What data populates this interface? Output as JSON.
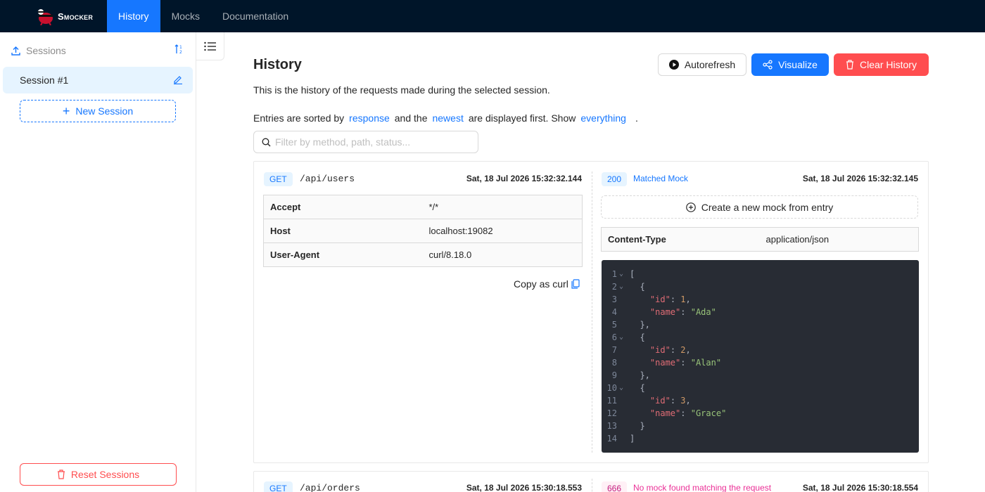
{
  "nav": {
    "brand": "Smocker",
    "tabs": [
      {
        "label": "History",
        "active": true
      },
      {
        "label": "Mocks",
        "active": false
      },
      {
        "label": "Documentation",
        "active": false
      }
    ]
  },
  "sidebar": {
    "sessions_label": "Sessions",
    "sessions": [
      {
        "name": "Session #1",
        "selected": true
      }
    ],
    "new_session_label": "New Session",
    "reset_sessions_label": "Reset Sessions"
  },
  "main": {
    "title": "History",
    "description": "This is the history of the requests made during the selected session.",
    "sort_line": {
      "p1": "Entries are sorted by",
      "sort_field": "response",
      "p2": "and the",
      "order": "newest",
      "p3": "are displayed first. Show",
      "show": "everything",
      "p4": "."
    },
    "buttons": {
      "autorefresh": "Autorefresh",
      "visualize": "Visualize",
      "clear": "Clear History"
    },
    "filter_placeholder": "Filter by method, path, status..."
  },
  "entries": [
    {
      "request": {
        "method": "GET",
        "path": "/api/users",
        "date": "Sat, 18 Jul 2026 15:32:32.144",
        "headers": [
          {
            "key": "Accept",
            "value": "*/*"
          },
          {
            "key": "Host",
            "value": "localhost:19082"
          },
          {
            "key": "User-Agent",
            "value": "curl/8.18.0"
          }
        ],
        "copy_curl": "Copy as curl"
      },
      "response": {
        "status": "200",
        "mock_status": "Matched Mock",
        "date": "Sat, 18 Jul 2026 15:32:32.145",
        "create_mock_label": "Create a new mock from entry",
        "headers": [
          {
            "key": "Content-Type",
            "value": "application/json"
          }
        ],
        "body_lines": [
          {
            "n": "1",
            "fold": true
          },
          {
            "n": "2",
            "fold": true
          },
          {
            "n": "3",
            "fold": false
          },
          {
            "n": "4",
            "fold": false
          },
          {
            "n": "5",
            "fold": false
          },
          {
            "n": "6",
            "fold": true
          },
          {
            "n": "7",
            "fold": false
          },
          {
            "n": "8",
            "fold": false
          },
          {
            "n": "9",
            "fold": false
          },
          {
            "n": "10",
            "fold": true
          },
          {
            "n": "11",
            "fold": false
          },
          {
            "n": "12",
            "fold": false
          },
          {
            "n": "13",
            "fold": false
          },
          {
            "n": "14",
            "fold": false
          }
        ],
        "body": {
          "key_id": "\"id\"",
          "key_name": "\"name\"",
          "items": [
            {
              "id": "1",
              "name": "\"Ada\""
            },
            {
              "id": "2",
              "name": "\"Alan\""
            },
            {
              "id": "3",
              "name": "\"Grace\""
            }
          ]
        }
      }
    },
    {
      "request": {
        "method": "GET",
        "path": "/api/orders",
        "date": "Sat, 18 Jul 2026 15:30:18.553"
      },
      "response": {
        "status": "666",
        "mock_status": "No mock found matching the request",
        "date": "Sat, 18 Jul 2026 15:30:18.554"
      }
    }
  ],
  "colors": {
    "nav_bg": "#001529",
    "primary": "#1677ff",
    "danger": "#ff4d4f",
    "code_bg": "#282c34"
  }
}
